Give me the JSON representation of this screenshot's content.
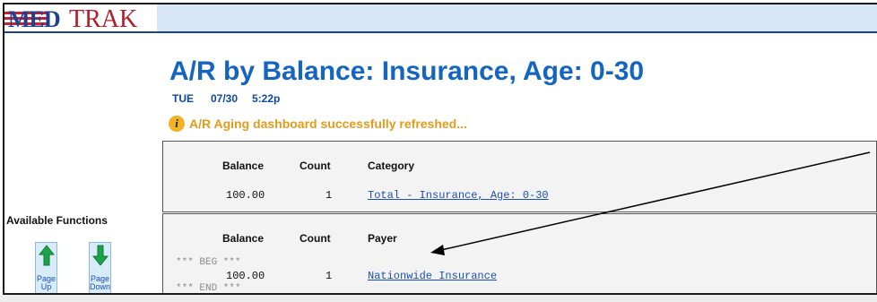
{
  "header": {
    "logo_med": "MED",
    "logo_trak": "TRAK"
  },
  "page": {
    "title": "A/R by Balance: Insurance, Age: 0-30",
    "day": "TUE",
    "date": "07/30",
    "time": "5:22p",
    "notice": "A/R Aging dashboard successfully refreshed...",
    "notice_icon": "info-icon"
  },
  "sidebar": {
    "title": "Available Functions",
    "page_up": {
      "label1": "Page",
      "label2": "Up",
      "icon": "arrow-up-icon"
    },
    "page_down": {
      "label1": "Page",
      "label2": "Down",
      "icon": "arrow-down-icon"
    }
  },
  "summary": {
    "columns": {
      "balance": "Balance",
      "count": "Count",
      "category": "Category"
    },
    "row": {
      "balance": "100.00",
      "count": "1",
      "category": "Total - Insurance, Age: 0-30"
    }
  },
  "detail": {
    "columns": {
      "balance": "Balance",
      "count": "Count",
      "payer": "Payer"
    },
    "beg_marker": "*** BEG ***",
    "row": {
      "balance": "100.00",
      "count": "1",
      "payer": "Nationwide Insurance"
    },
    "end_marker": "*** END ***"
  },
  "colors": {
    "title": "#1565c0",
    "notice": "#e39b1a",
    "link": "#1a4fb5",
    "panel": "#f3f3f3"
  }
}
